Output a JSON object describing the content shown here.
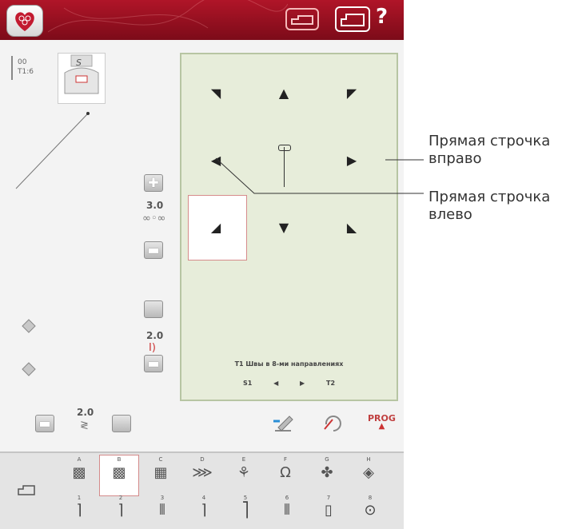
{
  "top_bar": {
    "help_label": "?"
  },
  "left_panel": {
    "needle_line1": "00",
    "needle_line2": "T1:6",
    "foot_label": "S",
    "stitch_length_value": "3.0",
    "stitch_width_value": "2.0",
    "balance_value": "2.0"
  },
  "stitch_panel": {
    "caption": "T1 Швы в 8-ми направлениях",
    "nav_prev": "S1",
    "nav_next": "T2"
  },
  "categories": [
    {
      "letter": "A",
      "icon": "utility-stitch-icon"
    },
    {
      "letter": "B",
      "icon": "utility-stitch-icon"
    },
    {
      "letter": "C",
      "icon": "utility-stitch-icon"
    },
    {
      "letter": "D",
      "icon": "decorative-stitch-icon"
    },
    {
      "letter": "E",
      "icon": "decorative-stitch-icon"
    },
    {
      "letter": "F",
      "icon": "buttonhole-icon"
    },
    {
      "letter": "G",
      "icon": "decorative-stitch-icon"
    },
    {
      "letter": "H",
      "icon": "decorative-stitch-icon"
    }
  ],
  "subcategories": [
    {
      "number": "1",
      "icon": "stitch-icon"
    },
    {
      "number": "2",
      "icon": "stitch-icon"
    },
    {
      "number": "3",
      "icon": "stitch-icon"
    },
    {
      "number": "4",
      "icon": "stitch-icon"
    },
    {
      "number": "5",
      "icon": "stitch-icon"
    },
    {
      "number": "6",
      "icon": "stitch-icon"
    },
    {
      "number": "7",
      "icon": "stitch-icon"
    },
    {
      "number": "8",
      "icon": "more-icon"
    }
  ],
  "bottom_tools": {
    "prog_label": "PROG"
  },
  "callouts": {
    "right_line1": "Прямая строчка",
    "right_line2": "вправо",
    "left_line1": "Прямая строчка",
    "left_line2": "влево"
  }
}
